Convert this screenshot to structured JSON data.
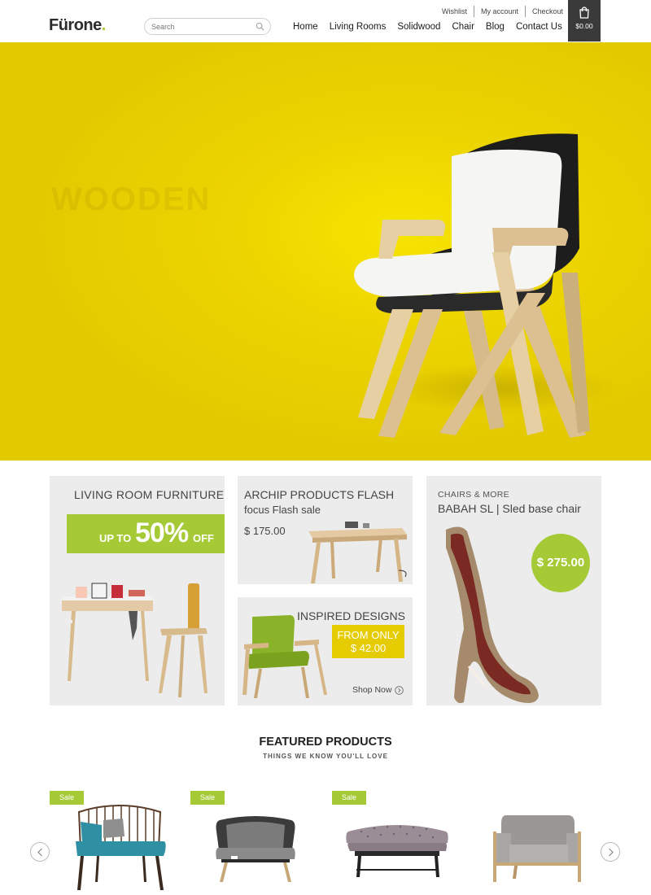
{
  "brand": {
    "name": "Fürone",
    "dot": "."
  },
  "search": {
    "placeholder": "Search"
  },
  "top_links": [
    "Wishlist",
    "My account",
    "Checkout"
  ],
  "nav": [
    "Home",
    "Living Rooms",
    "Solidwood",
    "Chair",
    "Blog",
    "Contact Us"
  ],
  "cart": {
    "total": "$0.00",
    "icon": "shopping-bag-icon"
  },
  "hero": {
    "text": "WOODEN"
  },
  "promos": {
    "living": {
      "title": "LIVING ROOM FURNITURE",
      "upto": "UP TO",
      "percent": "50%",
      "off": "OFF"
    },
    "archip": {
      "title": "ARCHIP PRODUCTS  FLASH",
      "subtitle": "focus Flash sale",
      "price": "$ 175.00"
    },
    "inspired": {
      "title": "INSPIRED DESIGNS",
      "line1": "FROM ONLY",
      "line2": "$ 42.00",
      "shop": "Shop Now"
    },
    "chairs": {
      "kicker": "CHAIRS & MORE",
      "title": "BABAH SL | Sled base chair",
      "price": "$ 275.00"
    }
  },
  "featured": {
    "title": "FEATURED PRODUCTS",
    "subtitle": "THINGS WE KNOW YOU'LL LOVE",
    "sale_label": "Sale"
  },
  "colors": {
    "accent_green": "#a6c936",
    "hero_yellow": "#ecd400",
    "dark": "#3a3a3a"
  }
}
